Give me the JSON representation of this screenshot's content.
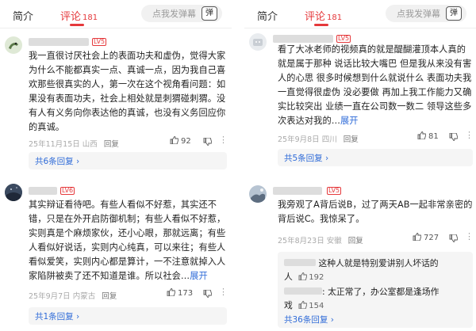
{
  "left": {
    "tabs": {
      "intro": "简介",
      "comments": "评论",
      "comment_count": "181"
    },
    "danmaku": {
      "placeholder": "点我发弹幕",
      "toggle": "弹"
    },
    "comments": [
      {
        "level": "LV5",
        "text": "我一直很讨厌社会上的表面功夫和虚伪，觉得大家为什么不能都真实一点、真诚一点，因为我自己喜欢那些很真实的人，第一次在这个视角看问题：如果没有表面功夫，社会上相处就是刺猬碰刺猬。没有人有义务向你表达他的真诚，也没有义务回应你的真诚。",
        "date": "25年11月15日",
        "location": "山西",
        "reply_label": "回复",
        "likes": "92",
        "replies_link": "共6条回复 ›"
      },
      {
        "level": "LV6",
        "text": "其实辩证看待吧。有些人看似不好惹，其实还不错，只是在外开启防御机制；有些人看似不好惹，实则真是个麻烦家伙，还小心眼，那就远离；有些人看似好说话，实则内心纯真，可以来往；有些人看似爱笑，实则内心都是算计，一不注意就掉入人家陷阱被卖了还不知道是谁。所以社会…",
        "expand": "展开",
        "date": "25年9月7日",
        "location": "内蒙古",
        "reply_label": "回复",
        "likes": "173",
        "replies_link": "共1条回复 ›"
      }
    ]
  },
  "right": {
    "tabs": {
      "intro": "简介",
      "comments": "评论",
      "comment_count": "181"
    },
    "danmaku": {
      "placeholder": "点我发弹幕",
      "toggle": "弹"
    },
    "comments": [
      {
        "level": "LV5",
        "text": "看了大冰老师的视频真的就是醍醐灌顶本人真的就是属于那种 说话比较大嘴巴 但是我从来没有害人的心思 很多时候想到什么就说什么 表面功夫我一直觉得很虚伪 没必要做 再加上我工作能力又确实比较突出 业绩一直在公司数一数二 领导这些多次表达对我的…",
        "expand": "展开",
        "date": "25年9月8日",
        "location": "四川",
        "reply_label": "回复",
        "likes": "81",
        "replies_link": "共5条回复 ›"
      },
      {
        "level": "LV5",
        "text": "我旁观了A背后说B，过了两天AB一起非常亲密的背后说C。我惊呆了。",
        "date": "25年8月23日",
        "location": "安徽",
        "reply_label": "回复",
        "likes": "727",
        "sub_replies": [
          {
            "text_a": "这种人就是特别爱讲别人坏话的",
            "text_b": "人",
            "likes": "192"
          },
          {
            "text_a": ": 太正常了，办公室都是逢场作",
            "text_b": "戏",
            "likes": "154"
          }
        ],
        "replies_link": "共36条回复 ›"
      }
    ]
  },
  "colors": {
    "accent": "#e5383b",
    "link": "#2f6bd8"
  },
  "icons": [
    "tv-danmaku-icon",
    "thumbs-up-icon",
    "thumbs-down-icon",
    "more-icon"
  ]
}
